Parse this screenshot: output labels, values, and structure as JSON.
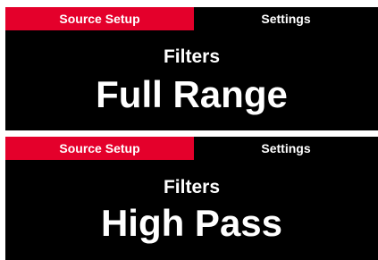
{
  "colors": {
    "active_tab": "#e4002b",
    "panel_bg": "#000000",
    "text": "#ffffff"
  },
  "screens": [
    {
      "tabs": [
        {
          "label": "Source Setup",
          "active": true
        },
        {
          "label": "Settings",
          "active": false
        }
      ],
      "parameter_label": "Filters",
      "parameter_value": "Full Range"
    },
    {
      "tabs": [
        {
          "label": "Source Setup",
          "active": true
        },
        {
          "label": "Settings",
          "active": false
        }
      ],
      "parameter_label": "Filters",
      "parameter_value": "High Pass"
    }
  ]
}
